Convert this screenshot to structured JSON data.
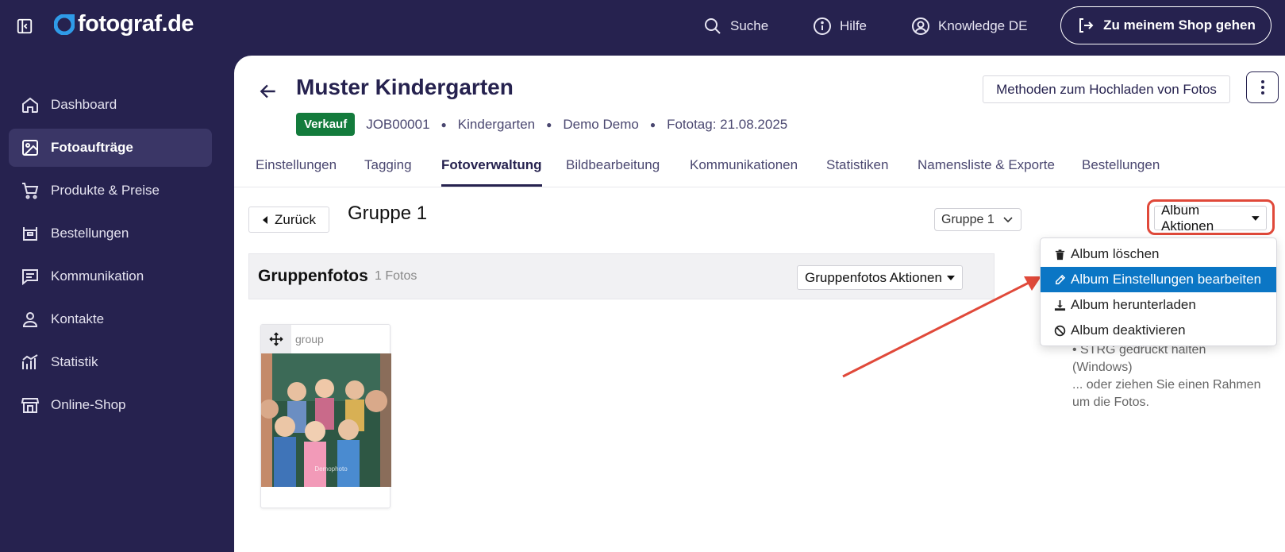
{
  "header": {
    "logo_text": "fotograf.de",
    "search_label": "Suche",
    "help_label": "Hilfe",
    "account_label": "Knowledge DE",
    "shop_button_label": "Zu meinem Shop gehen"
  },
  "sidebar": {
    "items": [
      {
        "label": "Dashboard",
        "icon": "home-icon"
      },
      {
        "label": "Fotoaufträge",
        "icon": "image-icon",
        "active": true
      },
      {
        "label": "Produkte & Preise",
        "icon": "cart-icon"
      },
      {
        "label": "Bestellungen",
        "icon": "box-icon"
      },
      {
        "label": "Kommunikation",
        "icon": "message-icon"
      },
      {
        "label": "Kontakte",
        "icon": "person-icon"
      },
      {
        "label": "Statistik",
        "icon": "chart-icon"
      },
      {
        "label": "Online-Shop",
        "icon": "store-icon"
      }
    ]
  },
  "job": {
    "title": "Muster Kindergarten",
    "status_badge": "Verkauf",
    "job_id": "JOB00001",
    "type": "Kindergarten",
    "customer": "Demo Demo",
    "photo_day": "Fototag: 21.08.2025",
    "upload_methods_label": "Methoden zum Hochladen von Fotos"
  },
  "tabs": [
    {
      "label": "Einstellungen"
    },
    {
      "label": "Tagging"
    },
    {
      "label": "Fotoverwaltung",
      "active": true
    },
    {
      "label": "Bildbearbeitung"
    },
    {
      "label": "Kommunikationen"
    },
    {
      "label": "Statistiken"
    },
    {
      "label": "Namensliste & Exporte"
    },
    {
      "label": "Bestellungen"
    }
  ],
  "toolbar": {
    "back_label": "Zurück",
    "group_title": "Gruppe 1",
    "group_select_value": "Gruppe 1",
    "album_actions_label": "Album Aktionen"
  },
  "section": {
    "title": "Gruppenfotos",
    "count": "1 Fotos",
    "actions_label": "Gruppenfotos Aktionen"
  },
  "photo": {
    "label": "group",
    "watermark": "Demophoto"
  },
  "help_lines": [
    "• STRG gedrückt halten (Windows)",
    "... oder ziehen Sie einen Rahmen um die Fotos."
  ],
  "dropdown": {
    "items": [
      {
        "label": "Album löschen",
        "icon": "trash-icon"
      },
      {
        "label": "Album Einstellungen bearbeiten",
        "icon": "pencil-icon",
        "highlighted": true
      },
      {
        "label": "Album herunterladen",
        "icon": "download-icon"
      },
      {
        "label": "Album deaktivieren",
        "icon": "ban-icon"
      }
    ]
  },
  "colors": {
    "nav_background": "#26224f",
    "highlight": "#0b76c5",
    "badge": "#137b3c",
    "annotation": "#e0493a"
  }
}
